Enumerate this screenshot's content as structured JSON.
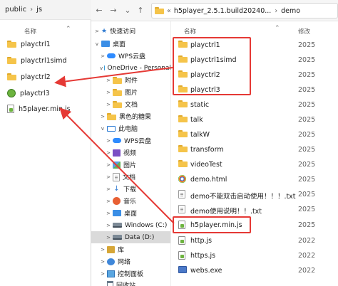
{
  "left_window": {
    "breadcrumb": [
      "public",
      "js"
    ],
    "col_name": "名称",
    "files": [
      {
        "name": "playctrl1",
        "icon": "folder-icon"
      },
      {
        "name": "playctrl1simd",
        "icon": "folder-icon"
      },
      {
        "name": "playctrl2",
        "icon": "folder-icon"
      },
      {
        "name": "playctrl3",
        "icon": "green-app-icon"
      },
      {
        "name": "h5player.min.js",
        "icon": "js-file-icon"
      }
    ]
  },
  "main_window": {
    "address": [
      "h5player_2.5.1.build20240...",
      "demo"
    ],
    "columns": {
      "name": "名称",
      "modified": "修改"
    },
    "nav_items": [
      {
        "label": "快速访问",
        "icon": "star-icon",
        "chev": ">"
      },
      {
        "label": "桌面",
        "icon": "desktop-icon",
        "chev": "v"
      },
      {
        "label": "WPS云盘",
        "icon": "cloud-icon",
        "chev": ">"
      },
      {
        "label": "OneDrive - Personal",
        "icon": "cloud-icon",
        "chev": "v"
      },
      {
        "label": "附件",
        "icon": "folder-icon",
        "chev": ">"
      },
      {
        "label": "图片",
        "icon": "folder-icon",
        "chev": ">"
      },
      {
        "label": "文档",
        "icon": "folder-icon",
        "chev": ">"
      },
      {
        "label": "黑色的糖果",
        "icon": "folder-icon",
        "chev": ">"
      },
      {
        "label": "此电脑",
        "icon": "pc-icon",
        "chev": "v"
      },
      {
        "label": "WPS云盘",
        "icon": "cloud-icon",
        "chev": ">"
      },
      {
        "label": "视频",
        "icon": "video-icon",
        "chev": ">"
      },
      {
        "label": "图片",
        "icon": "image-icon",
        "chev": ">"
      },
      {
        "label": "文档",
        "icon": "document-icon",
        "chev": ">"
      },
      {
        "label": "下载",
        "icon": "download-icon",
        "chev": ">"
      },
      {
        "label": "音乐",
        "icon": "music-icon",
        "chev": ">"
      },
      {
        "label": "桌面",
        "icon": "desktop-icon",
        "chev": ">"
      },
      {
        "label": "Windows (C:)",
        "icon": "drive-icon",
        "chev": ">"
      },
      {
        "label": "Data (D:)",
        "icon": "drive-icon",
        "chev": ">"
      },
      {
        "label": "库",
        "icon": "library-icon",
        "chev": ">"
      },
      {
        "label": "网络",
        "icon": "network-icon",
        "chev": ">"
      },
      {
        "label": "控制面板",
        "icon": "control-panel-icon",
        "chev": ">"
      },
      {
        "label": "回收站",
        "icon": "recycle-bin-icon",
        "chev": ""
      }
    ],
    "selected_nav_index": 17,
    "files": [
      {
        "name": "playctrl1",
        "icon": "folder-icon",
        "date": "2025"
      },
      {
        "name": "playctrl1simd",
        "icon": "folder-icon",
        "date": "2025"
      },
      {
        "name": "playctrl2",
        "icon": "folder-icon",
        "date": "2025"
      },
      {
        "name": "playctrl3",
        "icon": "folder-icon",
        "date": "2025"
      },
      {
        "name": "static",
        "icon": "folder-icon",
        "date": "2025"
      },
      {
        "name": "talk",
        "icon": "folder-icon",
        "date": "2025"
      },
      {
        "name": "talkW",
        "icon": "folder-icon",
        "date": "2025"
      },
      {
        "name": "transform",
        "icon": "folder-icon",
        "date": "2025"
      },
      {
        "name": "videoTest",
        "icon": "folder-icon",
        "date": "2025"
      },
      {
        "name": "demo.html",
        "icon": "html-file-icon",
        "date": "2025"
      },
      {
        "name": "demo不能双击启动使用！！！.txt",
        "icon": "text-file-icon",
        "date": "2025"
      },
      {
        "name": "demo使用说明！！.txt",
        "icon": "text-file-icon",
        "date": "2025"
      },
      {
        "name": "h5player.min.js",
        "icon": "js-file-icon",
        "date": "2025"
      },
      {
        "name": "http.js",
        "icon": "js-file-icon",
        "date": "2022"
      },
      {
        "name": "https.js",
        "icon": "js-file-icon",
        "date": "2022"
      },
      {
        "name": "webs.exe",
        "icon": "exe-file-icon",
        "date": "2022"
      }
    ]
  },
  "colors": {
    "annotation_red": "#e53935",
    "folder_yellow": "#f5c44a",
    "selection_grey": "#dadada"
  }
}
